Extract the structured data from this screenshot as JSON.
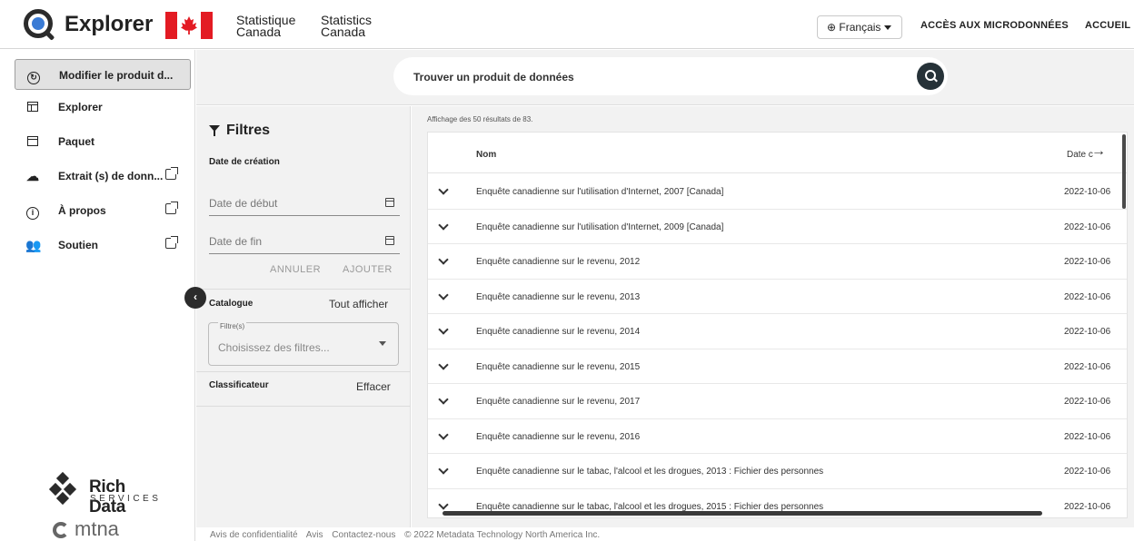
{
  "header": {
    "app_name": "Explorer",
    "statcan_fr_line1": "Statistique",
    "statcan_fr_line2": "Canada",
    "statcan_en_line1": "Statistics",
    "statcan_en_line2": "Canada",
    "language_label": "⊕ Français",
    "microdata_link": "ACCÈS AUX MICRODONNÉES",
    "home_link": "ACCUEIL"
  },
  "sidebar": {
    "items": [
      {
        "label": "Modifier le produit d...",
        "icon": "swap-icon",
        "external": false,
        "active": true
      },
      {
        "label": "Explorer",
        "icon": "table-icon",
        "external": false,
        "active": false
      },
      {
        "label": "Paquet",
        "icon": "package-icon",
        "external": false,
        "active": false
      },
      {
        "label": "Extrait (s) de donn...",
        "icon": "cloud-download-icon",
        "external": true,
        "active": false
      },
      {
        "label": "À propos",
        "icon": "info-icon",
        "external": true,
        "active": false
      },
      {
        "label": "Soutien",
        "icon": "users-icon",
        "external": true,
        "active": false
      }
    ],
    "rds_title": "Rich Data",
    "rds_subtitle": "SERVICES",
    "mtna": "mtna"
  },
  "search": {
    "placeholder": "Trouver un produit de données"
  },
  "filters": {
    "title": "Filtres",
    "date_section": "Date de création",
    "start_date_placeholder": "Date de début",
    "end_date_placeholder": "Date de fin",
    "cancel": "ANNULER",
    "add": "AJOUTER",
    "catalog_label": "Catalogue",
    "show_all": "Tout afficher",
    "filter_legend": "Filtre(s)",
    "filter_placeholder": "Choisissez des filtres...",
    "classifier_label": "Classificateur",
    "clear": "Effacer"
  },
  "results": {
    "count_text": "Affichage des 50 résultats de 83.",
    "columns": {
      "name": "Nom",
      "date": "Date c"
    },
    "rows": [
      {
        "name": "Enquête canadienne sur l'utilisation d'Internet, 2007 [Canada]",
        "date": "2022-10-06"
      },
      {
        "name": "Enquête canadienne sur l'utilisation d'Internet, 2009 [Canada]",
        "date": "2022-10-06"
      },
      {
        "name": "Enquête canadienne sur le revenu, 2012",
        "date": "2022-10-06"
      },
      {
        "name": "Enquête canadienne sur le revenu, 2013",
        "date": "2022-10-06"
      },
      {
        "name": "Enquête canadienne sur le revenu, 2014",
        "date": "2022-10-06"
      },
      {
        "name": "Enquête canadienne sur le revenu, 2015",
        "date": "2022-10-06"
      },
      {
        "name": "Enquête canadienne sur le revenu, 2017",
        "date": "2022-10-06"
      },
      {
        "name": "Enquête canadienne sur le revenu, 2016",
        "date": "2022-10-06"
      },
      {
        "name": "Enquête canadienne sur le tabac, l'alcool et les drogues, 2013 : Fichier des personnes",
        "date": "2022-10-06"
      },
      {
        "name": "Enquête canadienne sur le tabac, l'alcool et les drogues, 2015 : Fichier des personnes",
        "date": "2022-10-06"
      }
    ]
  },
  "footer": {
    "privacy": "Avis de confidentialité",
    "notice": "Avis",
    "contact": "Contactez-nous",
    "copyright": "© 2022 Metadata Technology North America Inc."
  },
  "colors": {
    "flag_red": "#e31b23",
    "panel_bg": "#f2f2f2",
    "active_nav": "#e2e2e2",
    "search_button": "#263238"
  }
}
